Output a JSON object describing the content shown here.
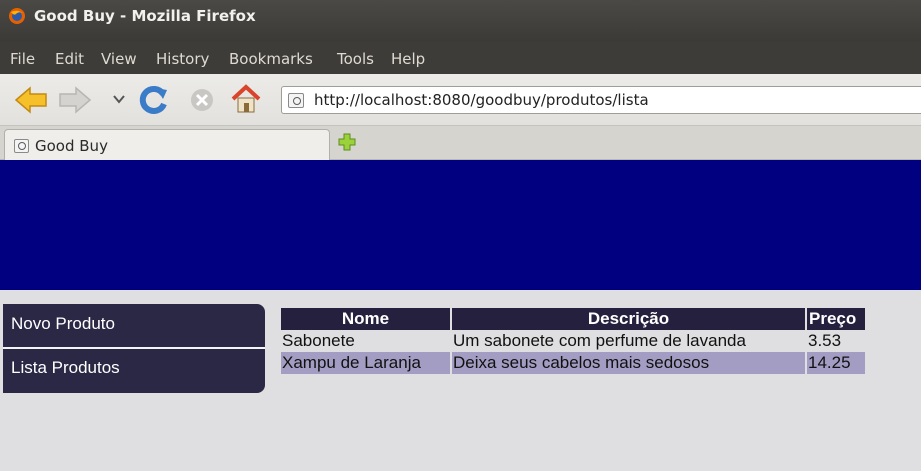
{
  "window": {
    "title": "Good Buy - Mozilla Firefox"
  },
  "menu": {
    "items": [
      "File",
      "Edit",
      "View",
      "History",
      "Bookmarks",
      "Tools",
      "Help"
    ]
  },
  "navbar": {
    "url": "http://localhost:8080/goodbuy/produtos/lista"
  },
  "tabs": [
    {
      "label": "Good Buy"
    }
  ],
  "page": {
    "sidebar": {
      "items": [
        "Novo Produto",
        "Lista Produtos"
      ]
    },
    "table": {
      "headers": [
        "Nome",
        "Descrição",
        "Preço"
      ],
      "rows": [
        [
          "Sabonete",
          "Um sabonete com perfume de lavanda",
          "3.53"
        ],
        [
          "Xampu de Laranja",
          "Deixa seus cabelos mais sedosos",
          "14.25"
        ]
      ]
    }
  },
  "colors": {
    "header_band": "#000080",
    "menu_bg": "#2b2846",
    "table_header": "#26203f",
    "row_alt": "#a39cc3"
  }
}
